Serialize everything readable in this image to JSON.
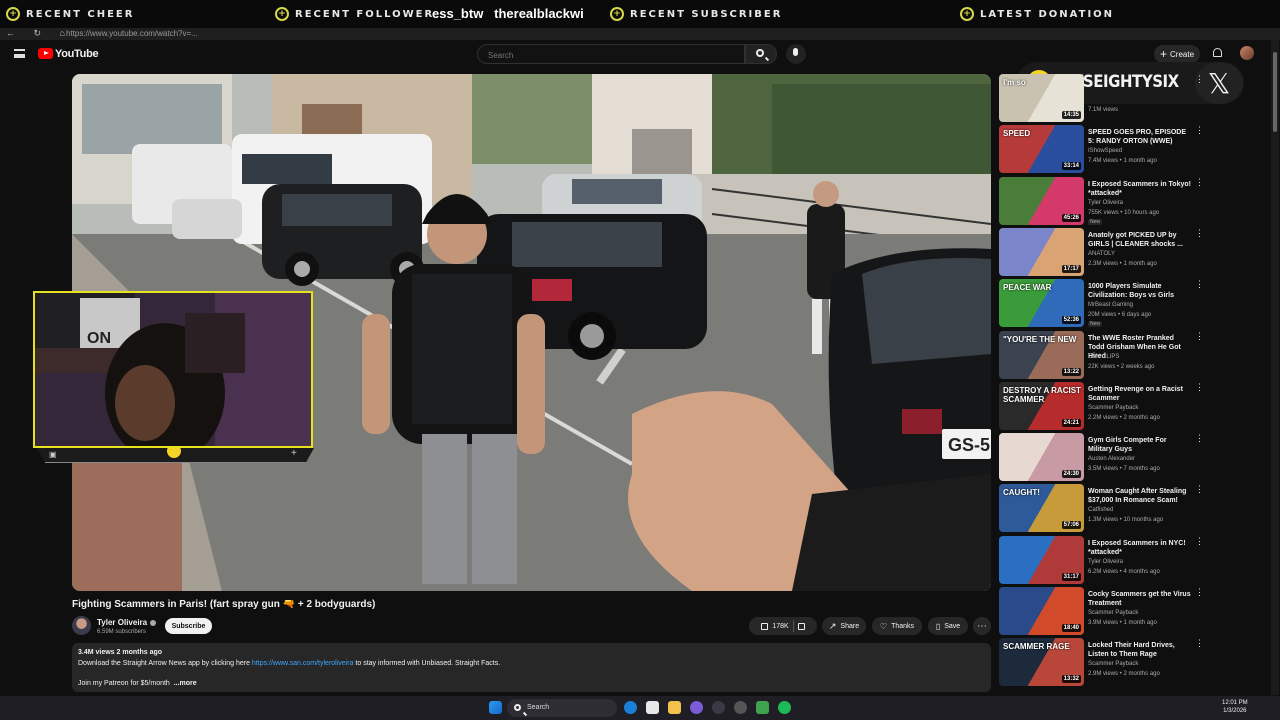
{
  "overlay": {
    "recent_cheer": "RECENT CHEER",
    "recent_follower": "RECENT FOLLOWER",
    "follower_names": "ess_btw   therealblackwi",
    "recent_subscriber": "RECENT SUBSCRIBER",
    "latest_donation": "LATEST DONATION",
    "streamer_name": "ITSEIGHTYSIX",
    "social_icon": "x-logo-icon"
  },
  "browser": {
    "url": "https://www.youtube.com/watch?v=...",
    "nav_glyphs": "← ↻ ⌂"
  },
  "header": {
    "logo_text": "YouTube",
    "search_placeholder": "Search",
    "create_label": "Create"
  },
  "video": {
    "title": "Fighting Scammers in Paris! (fart spray gun 🔫 + 2 bodyguards)",
    "channel": "Tyler Oliveira",
    "subscribers": "6.59M subscribers",
    "subscribe_label": "Subscribe",
    "likes": "178K",
    "share_label": "Share",
    "thanks_label": "Thanks",
    "save_label": "Save",
    "more_glyph": "⋯",
    "plate_text": "GS-5",
    "webcam_sign": "ON"
  },
  "description": {
    "stats": "3.4M views  2 months ago",
    "line1_prefix": "Download the Straight Arrow News app by clicking here ",
    "line1_link": "https://www.san.com/tyleroliveira",
    "line1_suffix": " to stay informed with Unbiased. Straight Facts.",
    "line2": "Join my Patreon for $5/month  ",
    "more_label": "...more"
  },
  "recommendations": [
    {
      "title": "",
      "channel": "",
      "stats": "7.1M views",
      "duration": "14:35",
      "badge": "",
      "thumb_colors": [
        "#c9c2b0",
        "#e7e2d6"
      ],
      "thumb_label": "I'm so"
    },
    {
      "title": "SPEED GOES PRO, EPISODE 5: RANDY ORTON (WWE)",
      "channel": "IShowSpeed",
      "stats": "7.4M views • 1 month ago",
      "duration": "33:14",
      "badge": "",
      "thumb_colors": [
        "#b73a3a",
        "#2a4e9e"
      ],
      "thumb_label": "SPEED"
    },
    {
      "title": "I Exposed Scammers in Tokyo! *attacked*",
      "channel": "Tyler Oliveira",
      "stats": "755K views • 10 hours ago",
      "duration": "45:26",
      "badge": "New",
      "thumb_colors": [
        "#4a7d3a",
        "#d33a6a"
      ],
      "thumb_label": ""
    },
    {
      "title": "Anatoly got PICKED UP by GIRLS | CLEANER shocks ...",
      "channel": "ANATOLY",
      "stats": "2.3M views • 1 month ago",
      "duration": "17:17",
      "badge": "",
      "thumb_colors": [
        "#7a86c9",
        "#d9a373"
      ],
      "thumb_label": ""
    },
    {
      "title": "1000 Players Simulate Civilization: Boys vs Girls",
      "channel": "MrBeast Gaming",
      "stats": "20M views • 6 days ago",
      "duration": "52:36",
      "badge": "New",
      "thumb_colors": [
        "#3a9b3a",
        "#2f6bb8"
      ],
      "thumb_label": "PEACE  WAR"
    },
    {
      "title": "The WWE Roster Pranked Todd Grisham When He Got Hired",
      "channel": "CVV CLIPS",
      "stats": "22K views • 2 weeks ago",
      "duration": "13:22",
      "badge": "",
      "thumb_colors": [
        "#3b4350",
        "#9b6b5a"
      ],
      "thumb_label": "\"YOU'RE THE NEW"
    },
    {
      "title": "Getting Revenge on a Racist Scammer",
      "channel": "Scammer Payback",
      "stats": "2.2M views • 2 months ago",
      "duration": "24:21",
      "badge": "",
      "thumb_colors": [
        "#2a2a2a",
        "#b62b2b"
      ],
      "thumb_label": "DESTROY A RACIST SCAMMER"
    },
    {
      "title": "Gym Girls Compete For Military Guys",
      "channel": "Austen Alexander",
      "stats": "3.5M views • 7 months ago",
      "duration": "24:30",
      "badge": "",
      "thumb_colors": [
        "#e7d8d1",
        "#c89aa3"
      ],
      "thumb_label": ""
    },
    {
      "title": "Woman Caught After Stealing $37,000 In Romance Scam!",
      "channel": "Catfished",
      "stats": "1.3M views • 10 months ago",
      "duration": "57:06",
      "badge": "",
      "thumb_colors": [
        "#2f5a9a",
        "#c79b3a"
      ],
      "thumb_label": "CAUGHT!"
    },
    {
      "title": "I Exposed Scammers in NYC! *attacked*",
      "channel": "Tyler Oliveira",
      "stats": "6.2M views • 4 months ago",
      "duration": "31:17",
      "badge": "",
      "thumb_colors": [
        "#2b6fc2",
        "#b03a3a"
      ],
      "thumb_label": ""
    },
    {
      "title": "Cocky Scammers get the Virus Treatment",
      "channel": "Scammer Payback",
      "stats": "3.9M views • 1 month ago",
      "duration": "18:40",
      "badge": "",
      "thumb_colors": [
        "#2a4a8a",
        "#d14a2a"
      ],
      "thumb_label": ""
    },
    {
      "title": "Locked Their Hard Drives, Listen to Them Rage",
      "channel": "Scammer Payback",
      "stats": "2.9M views • 2 months ago",
      "duration": "13:32",
      "badge": "",
      "thumb_colors": [
        "#1c2a3c",
        "#b8473a"
      ],
      "thumb_label": "SCAMMER RAGE"
    }
  ],
  "taskbar": {
    "search_label": "Search",
    "time": "12:01 PM",
    "date": "1/3/2026"
  }
}
